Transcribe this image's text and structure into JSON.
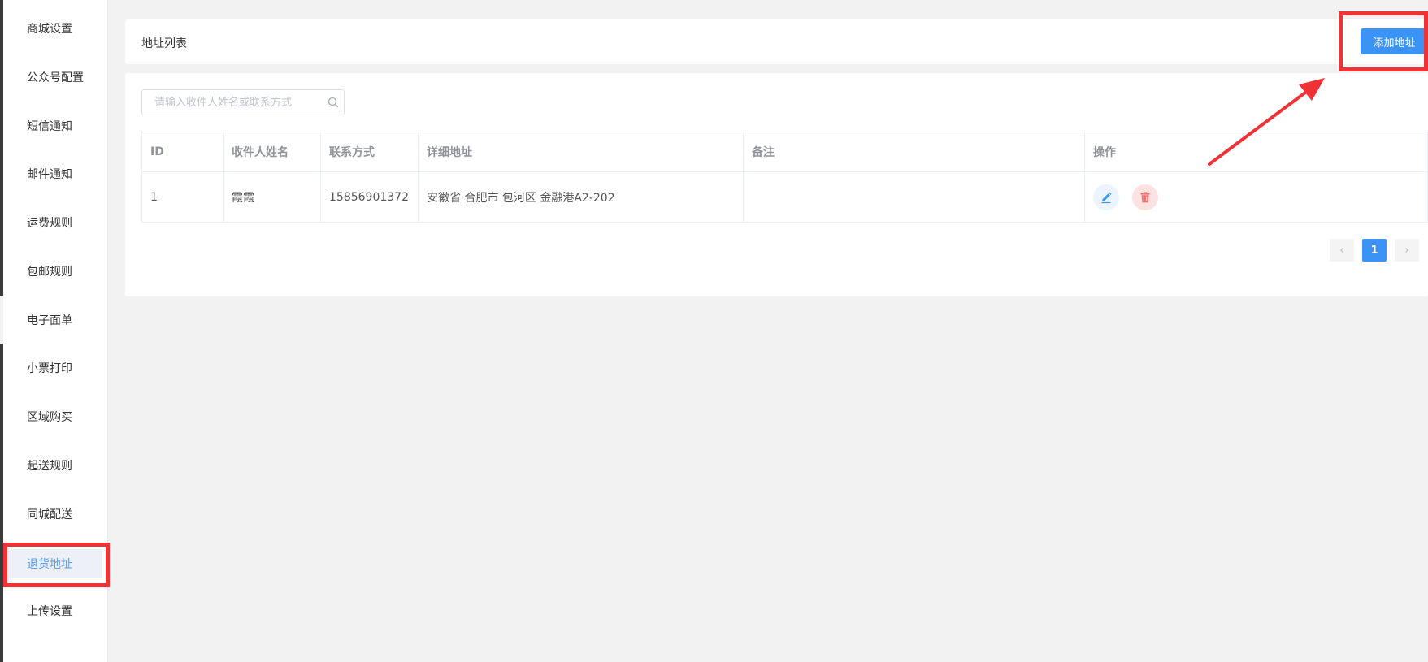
{
  "sidebar": {
    "items": [
      {
        "label": "商城设置"
      },
      {
        "label": "公众号配置"
      },
      {
        "label": "短信通知"
      },
      {
        "label": "邮件通知"
      },
      {
        "label": "运费规则"
      },
      {
        "label": "包邮规则"
      },
      {
        "label": "电子面单"
      },
      {
        "label": "小票打印"
      },
      {
        "label": "区域购买"
      },
      {
        "label": "起送规则"
      },
      {
        "label": "同城配送"
      },
      {
        "label": "退货地址"
      },
      {
        "label": "上传设置"
      }
    ],
    "active_index": 11
  },
  "header": {
    "title": "地址列表",
    "add_button_label": "添加地址"
  },
  "search": {
    "placeholder": "请输入收件人姓名或联系方式",
    "value": ""
  },
  "table": {
    "columns": [
      "ID",
      "收件人姓名",
      "联系方式",
      "详细地址",
      "备注",
      "操作"
    ],
    "rows": [
      {
        "id": "1",
        "name": "霞霞",
        "phone": "15856901372",
        "address": "安徽省 合肥市 包河区 金融港A2-202",
        "note": ""
      }
    ]
  },
  "pagination": {
    "current_page": "1",
    "prev_symbol": "‹",
    "next_symbol": "›"
  },
  "colors": {
    "primary": "#3b94f5",
    "danger": "#f56c6c",
    "annotation": "#ee3236"
  },
  "icons": {
    "search": "search-icon",
    "edit": "pencil-icon",
    "delete": "trash-icon",
    "prev": "chevron-left-icon",
    "next": "chevron-right-icon"
  }
}
